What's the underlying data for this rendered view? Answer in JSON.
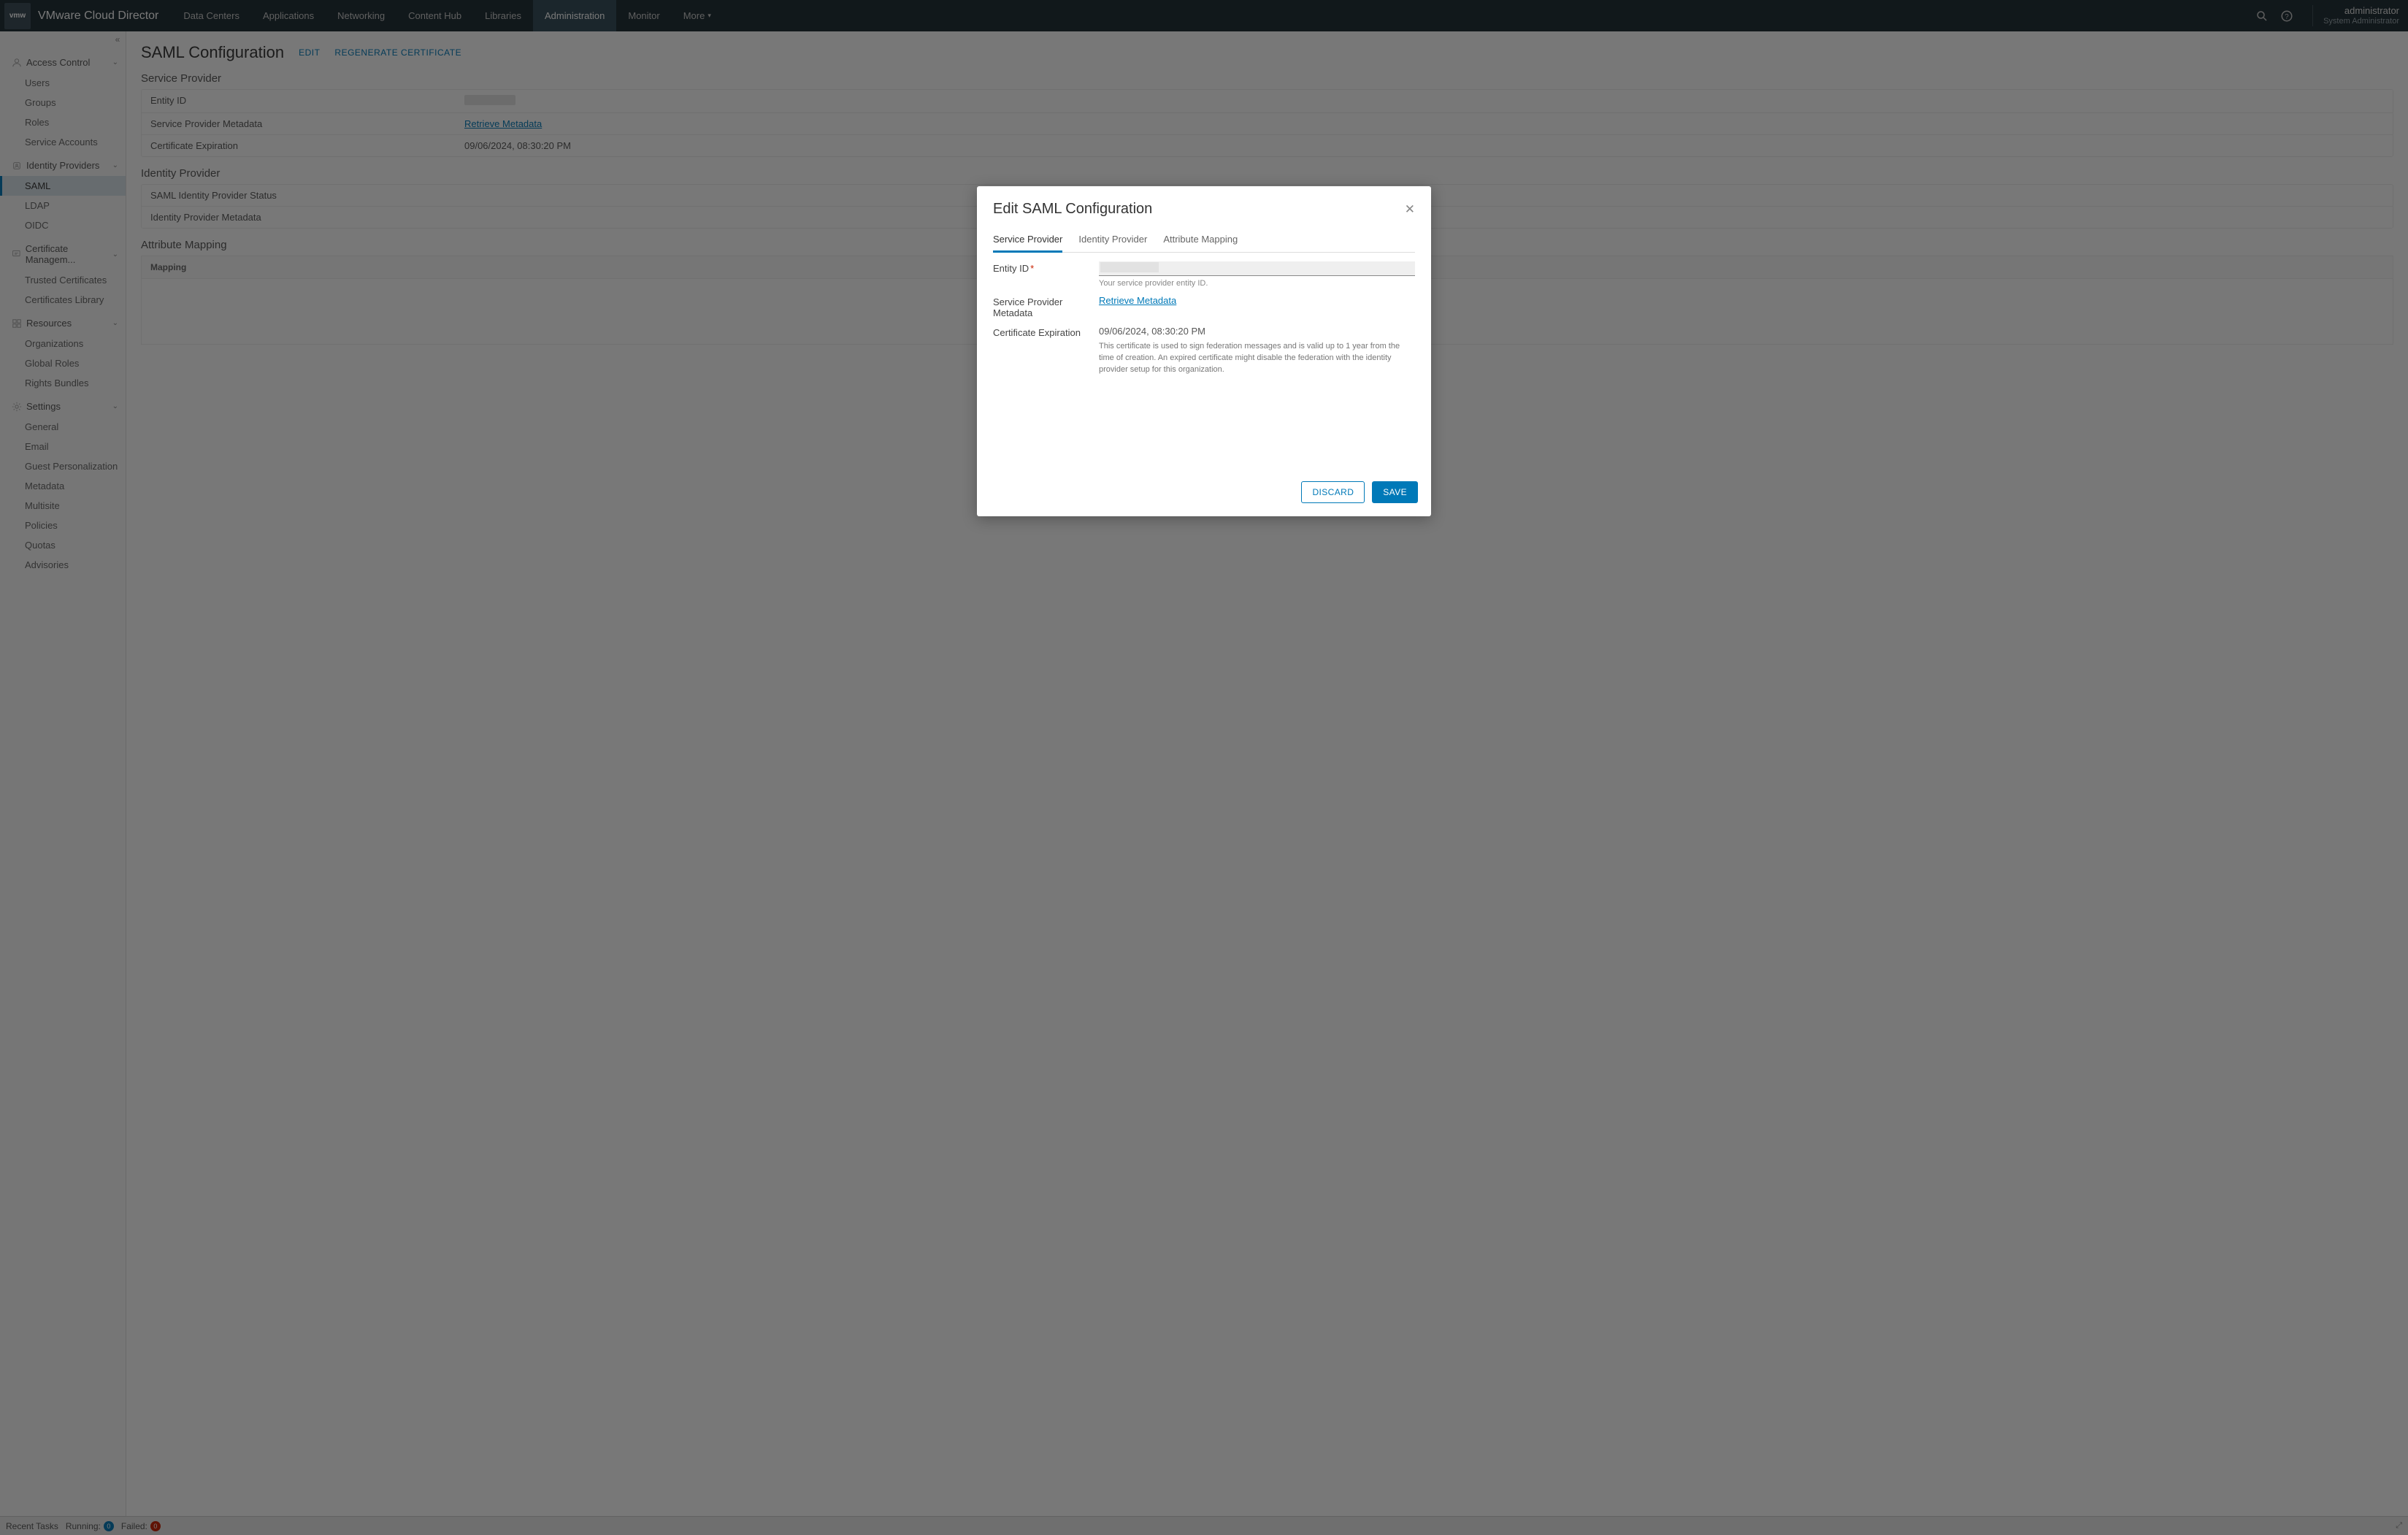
{
  "brand": "VMware Cloud Director",
  "topnav": {
    "items": [
      "Data Centers",
      "Applications",
      "Networking",
      "Content Hub",
      "Libraries",
      "Administration",
      "Monitor"
    ],
    "more": "More",
    "active_index": 5
  },
  "user": {
    "name": "administrator",
    "role": "System Administrator"
  },
  "sidebar": {
    "sections": [
      {
        "label": "Access Control",
        "items": [
          "Users",
          "Groups",
          "Roles",
          "Service Accounts"
        ]
      },
      {
        "label": "Identity Providers",
        "items": [
          "SAML",
          "LDAP",
          "OIDC"
        ],
        "active_item_index": 0
      },
      {
        "label": "Certificate Managem...",
        "items": [
          "Trusted Certificates",
          "Certificates Library"
        ]
      },
      {
        "label": "Resources",
        "items": [
          "Organizations",
          "Global Roles",
          "Rights Bundles"
        ]
      },
      {
        "label": "Settings",
        "items": [
          "General",
          "Email",
          "Guest Personalization",
          "Metadata",
          "Multisite",
          "Policies",
          "Quotas",
          "Advisories"
        ]
      }
    ]
  },
  "page": {
    "title": "SAML Configuration",
    "actions": {
      "edit": "EDIT",
      "regenerate": "REGENERATE CERTIFICATE"
    },
    "service_provider": {
      "heading": "Service Provider",
      "rows": {
        "entity_id_label": "Entity ID",
        "sp_meta_label": "Service Provider Metadata",
        "sp_meta_link": "Retrieve Metadata",
        "cert_exp_label": "Certificate Expiration",
        "cert_exp_value": "09/06/2024, 08:30:20 PM"
      }
    },
    "identity_provider": {
      "heading": "Identity Provider",
      "rows": {
        "status_label": "SAML Identity Provider Status",
        "idp_meta_label": "Identity Provider Metadata"
      }
    },
    "attribute_mapping": {
      "heading": "Attribute Mapping",
      "col": "Mapping"
    }
  },
  "modal": {
    "title": "Edit SAML Configuration",
    "tabs": [
      "Service Provider",
      "Identity Provider",
      "Attribute Mapping"
    ],
    "active_tab_index": 0,
    "fields": {
      "entity_id_label": "Entity ID",
      "entity_id_hint": "Your service provider entity ID.",
      "sp_meta_label": "Service Provider Metadata",
      "sp_meta_link": "Retrieve Metadata",
      "cert_exp_label": "Certificate Expiration",
      "cert_exp_value": "09/06/2024, 08:30:20 PM",
      "cert_note": "This certificate is used to sign federation messages and is valid up to 1 year from the time of creation. An expired certificate might disable the federation with the identity provider setup for this organization."
    },
    "buttons": {
      "discard": "DISCARD",
      "save": "SAVE"
    }
  },
  "statusbar": {
    "recent": "Recent Tasks",
    "running": "Running:",
    "running_count": "0",
    "failed": "Failed:",
    "failed_count": "0"
  },
  "icons": {
    "vmw": "vmw"
  }
}
